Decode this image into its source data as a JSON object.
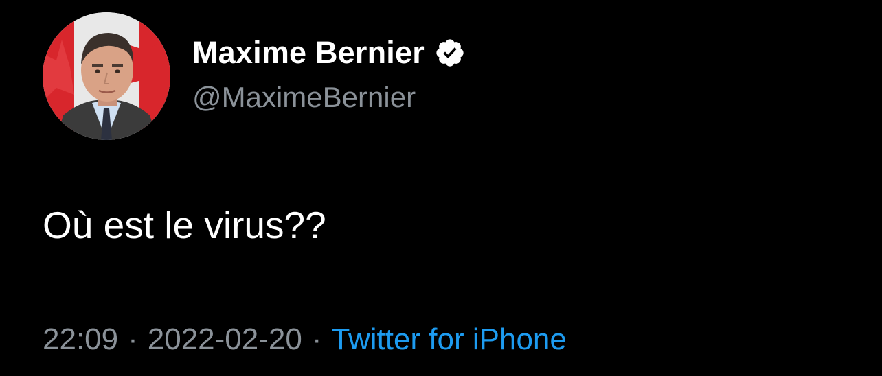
{
  "author": {
    "display_name": "Maxime Bernier",
    "handle": "@MaximeBernier",
    "verified_icon": "verified-badge-icon"
  },
  "tweet": {
    "text": "Où est le virus??",
    "time": "22:09",
    "separator": "·",
    "date": "2022-02-20",
    "source": "Twitter for iPhone"
  },
  "colors": {
    "background": "#000000",
    "primary_text": "#ffffff",
    "secondary_text": "#8b9299",
    "link": "#1d9bf0"
  }
}
